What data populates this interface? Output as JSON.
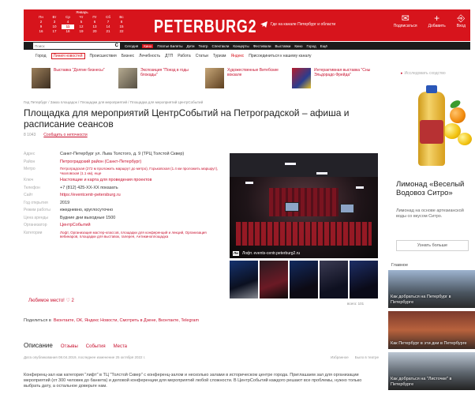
{
  "calendar": {
    "month": "Январь",
    "days": [
      "Пн",
      "Вт",
      "Ср",
      "Чт",
      "Пт",
      "Сб",
      "Вс"
    ],
    "rows": [
      [
        "2",
        "3",
        "4",
        "5",
        "6",
        "7",
        "8"
      ],
      [
        "9",
        "10",
        "11",
        "12",
        "13",
        "14",
        "15"
      ],
      [
        "16",
        "17",
        "18",
        "19",
        "20",
        "21",
        "22"
      ]
    ],
    "today": "11"
  },
  "header": {
    "logo": "PETERBURG2",
    "telegram_text": "Где на канале Петербург и области",
    "icons": [
      {
        "icon": "subscribe-icon",
        "glyph": "✉",
        "label": "Подписаться"
      },
      {
        "icon": "add-icon",
        "glyph": "+",
        "label": "Добавить"
      },
      {
        "icon": "login-icon",
        "glyph": "⎆",
        "label": "Вход"
      }
    ]
  },
  "nav": {
    "search_placeholder": "Поиск",
    "items": [
      "Сегодня",
      "Кино",
      "Платье Билеты",
      "Дети",
      "Театр",
      "Спектакли",
      "Концерты",
      "Фестивали",
      "Выставки",
      "Кино",
      "Город",
      "Ещё"
    ],
    "active": "Кино"
  },
  "subnav": {
    "items": [
      "Город",
      "Линия новостей",
      "Происшествия",
      "Бизнес",
      "Лечебность",
      "ДТП",
      "Работа",
      "Статьи",
      "Туризм",
      "Яндекс",
      "Присоединиться к нашему каналу"
    ],
    "highlight": "Линия новостей"
  },
  "promo": [
    {
      "text": "Выставка \"Долгие бизнесы\""
    },
    {
      "text": "Экспозиция \"Поезд в годы блокады\""
    },
    {
      "text": "Художественные Витебские вокзале"
    },
    {
      "text": "Интерактивная выставка \"Сны Эльдорадо Фрейда\""
    }
  ],
  "breadcrumb": "Гид Петербург / Заказ площадок / Площадки для мероприятий / Площадка для мероприятий ЦентрСобытий",
  "title": "Площадка для мероприятий ЦентрСобытий на Петроградской – афиша и расписание сеансов",
  "meta": {
    "views": "8 1043",
    "report": "Сообщить о неточности"
  },
  "info": [
    {
      "key": "Адрес",
      "value": "Санкт-Петербург ул. Льва Толстого, д. 9 (ТРЦ Толстой Сквер)",
      "red": false
    },
    {
      "key": "Район",
      "value": "Петроградский район (Санкт-Петербург)",
      "red": true
    },
    {
      "key": "Метро",
      "value": "Петроградская (272 м проложить маршрут до метро), Горьковская (1.4 км проложить маршрут), Чкаловская (1.1 км), еще",
      "red": true
    },
    {
      "key": "Ключ",
      "value": "Настоящие и карта для проведения проектов",
      "red": true
    },
    {
      "key": "Телефон",
      "value": "+7 (812) 425-XX-XX показать",
      "red": false
    },
    {
      "key": "Сайт",
      "value": "https://eventcentr-petersburg.ru",
      "red": true
    },
    {
      "key": "Год открытия",
      "value": "2019",
      "red": false
    },
    {
      "key": "Режим работы",
      "value": "ежедневно, круглосуточно",
      "red": false
    },
    {
      "key": "Цена аренды",
      "value": "Будние дни выходные 1500",
      "red": false
    },
    {
      "key": "Организатор",
      "value": "ЦентрСобытий",
      "red": true
    },
    {
      "key": "Категории",
      "value": "Лофт, Организация мастер-классов, площадки для конференций и лекций, Организация вебинаров, площадки для выставок, галерея, Антикиноплощадка",
      "red": true
    }
  ],
  "photo": {
    "brand": "Ли",
    "caption": "Лофт. events-centr.peterburg2.ru",
    "count": "всего: 101"
  },
  "ask": "Любимое место! ♡ 2",
  "share": {
    "label": "Поделиться в",
    "items": "Вконтакте, ОК, Яндекс Новости, Смотреть в Дзене, Вконтакте, Telegram"
  },
  "tabs": [
    "Описание",
    "Отзывы",
    "События",
    "Места"
  ],
  "dates": {
    "left": "Дата опубликования 08.04.2019, последнее изменение 25 октября 2022 г.",
    "right_links": [
      "Избранное",
      "Было в театре"
    ]
  },
  "description": "Конференц-зал как категория \"лифт\" в ТЦ \"Толстой Сквер\" с конференц-залом и несколько залами в историческом центре города. Приглашаем зал для организации мероприятий (от 300 человек до банкета) и деловой конференции для мероприятий любой сложности. В ЦентрСобытий каждого решают все проблемы, нужно только выбрать дату, а остальное доверьте нам.",
  "sidebar": {
    "snippet": "Исследовать сходство",
    "ad": {
      "title": "Лимонад «Веселый Водовоз Ситро»",
      "desc": "Лимонад на основе артезианской воды со вкусом Ситро.",
      "button": "Узнать больше"
    },
    "news_heading": "Главное",
    "news": [
      {
        "caption": "Как добраться на Петербург в Петербурге"
      },
      {
        "caption": "Как Петербург в эти дни в Петербурге"
      },
      {
        "caption": "Как добраться на \"Листочке\" в Петербурге"
      }
    ]
  }
}
